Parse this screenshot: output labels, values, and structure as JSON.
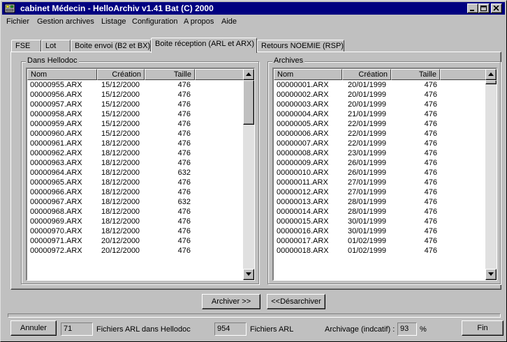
{
  "window": {
    "title": "cabinet Médecin - HelloArchiv v1.41 Bat (C) 2000"
  },
  "menu": [
    {
      "label": "Fichier"
    },
    {
      "label": "Gestion archives"
    },
    {
      "label": "Listage"
    },
    {
      "label": "Configuration"
    },
    {
      "label": "A propos"
    },
    {
      "label": "Aide"
    }
  ],
  "tabs": [
    {
      "label": "FSE"
    },
    {
      "label": "Lot"
    },
    {
      "label": "Boite envoi (B2 et BX)"
    },
    {
      "label": "Boite réception (ARL et ARX)"
    },
    {
      "label": "Retours NOEMIE (RSP)"
    }
  ],
  "left_panel": {
    "title": "Dans Hellodoc",
    "columns": [
      "Nom",
      "Création",
      "Taille"
    ],
    "rows": [
      [
        "00000955.ARX",
        "15/12/2000",
        "476"
      ],
      [
        "00000956.ARX",
        "15/12/2000",
        "476"
      ],
      [
        "00000957.ARX",
        "15/12/2000",
        "476"
      ],
      [
        "00000958.ARX",
        "15/12/2000",
        "476"
      ],
      [
        "00000959.ARX",
        "15/12/2000",
        "476"
      ],
      [
        "00000960.ARX",
        "15/12/2000",
        "476"
      ],
      [
        "00000961.ARX",
        "18/12/2000",
        "476"
      ],
      [
        "00000962.ARX",
        "18/12/2000",
        "476"
      ],
      [
        "00000963.ARX",
        "18/12/2000",
        "476"
      ],
      [
        "00000964.ARX",
        "18/12/2000",
        "632"
      ],
      [
        "00000965.ARX",
        "18/12/2000",
        "476"
      ],
      [
        "00000966.ARX",
        "18/12/2000",
        "476"
      ],
      [
        "00000967.ARX",
        "18/12/2000",
        "632"
      ],
      [
        "00000968.ARX",
        "18/12/2000",
        "476"
      ],
      [
        "00000969.ARX",
        "18/12/2000",
        "476"
      ],
      [
        "00000970.ARX",
        "18/12/2000",
        "476"
      ],
      [
        "00000971.ARX",
        "20/12/2000",
        "476"
      ],
      [
        "00000972.ARX",
        "20/12/2000",
        "476"
      ]
    ]
  },
  "right_panel": {
    "title": "Archives",
    "columns": [
      "Nom",
      "Création",
      "Taille"
    ],
    "rows": [
      [
        "00000001.ARX",
        "20/01/1999",
        "476"
      ],
      [
        "00000002.ARX",
        "20/01/1999",
        "476"
      ],
      [
        "00000003.ARX",
        "20/01/1999",
        "476"
      ],
      [
        "00000004.ARX",
        "21/01/1999",
        "476"
      ],
      [
        "00000005.ARX",
        "22/01/1999",
        "476"
      ],
      [
        "00000006.ARX",
        "22/01/1999",
        "476"
      ],
      [
        "00000007.ARX",
        "22/01/1999",
        "476"
      ],
      [
        "00000008.ARX",
        "23/01/1999",
        "476"
      ],
      [
        "00000009.ARX",
        "26/01/1999",
        "476"
      ],
      [
        "00000010.ARX",
        "26/01/1999",
        "476"
      ],
      [
        "00000011.ARX",
        "27/01/1999",
        "476"
      ],
      [
        "00000012.ARX",
        "27/01/1999",
        "476"
      ],
      [
        "00000013.ARX",
        "28/01/1999",
        "476"
      ],
      [
        "00000014.ARX",
        "28/01/1999",
        "476"
      ],
      [
        "00000015.ARX",
        "30/01/1999",
        "476"
      ],
      [
        "00000016.ARX",
        "30/01/1999",
        "476"
      ],
      [
        "00000017.ARX",
        "01/02/1999",
        "476"
      ],
      [
        "00000018.ARX",
        "01/02/1999",
        "476"
      ]
    ]
  },
  "actions": {
    "archive": "Archiver >>",
    "unarchive": "<<Désarchiver"
  },
  "footer": {
    "cancel": "Annuler",
    "arl_count": "71",
    "arl_count_label": "Fichiers ARL dans Hellodoc",
    "arl_total": "954",
    "arl_total_label": "Fichiers ARL",
    "archiving_label": "Archivage (indcatif) :",
    "archiving_value": "93",
    "archiving_unit": "%",
    "finish": "Fin"
  }
}
